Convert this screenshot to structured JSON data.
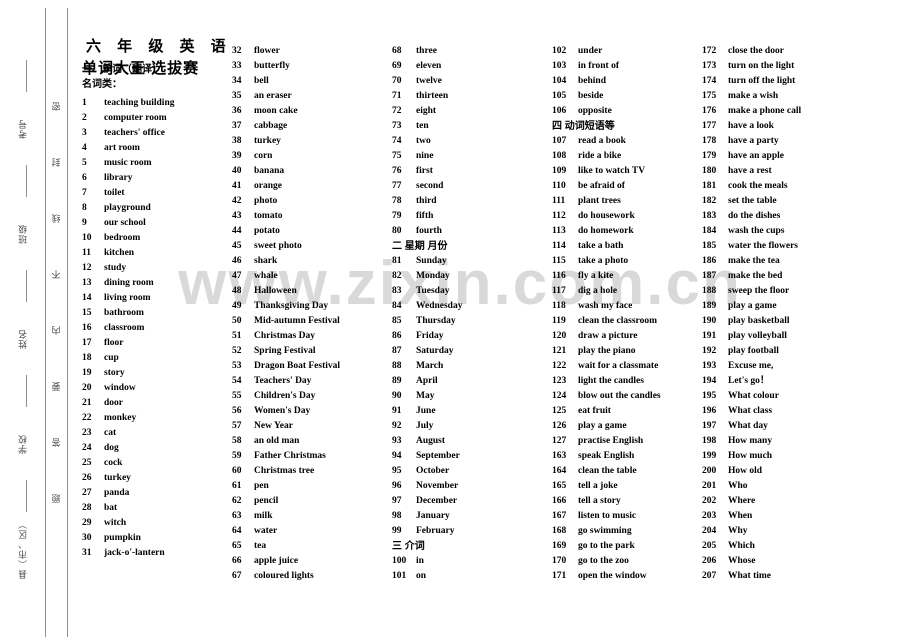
{
  "watermark": {
    "text": "www.zixin.com.cn"
  },
  "seal": {
    "outer_labels": [
      "考号",
      "班级",
      "姓名",
      "学校",
      "县（市、区）"
    ],
    "inner_chars": [
      "密",
      "封",
      "线",
      "不",
      "内",
      "要",
      "答",
      "题"
    ],
    "inner_text": "密封线内不要答题"
  },
  "header": {
    "title_line_1": "六 年 级 英 语",
    "title_line_2": "单词大王 选拔赛"
  },
  "sections": {
    "part_1": "一、单词（翻译）",
    "part_1_sub": "名词类：",
    "part_2": "二 星期 月份",
    "part_3": "三 介词",
    "part_4": "四 动词短语等"
  },
  "columns": [
    {
      "id": "col-1",
      "entries": [
        {
          "num": "1",
          "word": "teaching building"
        },
        {
          "num": "2",
          "word": "computer room"
        },
        {
          "num": "3",
          "word": "teachers' office"
        },
        {
          "num": "4",
          "word": "art    room"
        },
        {
          "num": "5",
          "word": "music    room"
        },
        {
          "num": "6",
          "word": "library"
        },
        {
          "num": "7",
          "word": "toilet"
        },
        {
          "num": "8",
          "word": "playground"
        },
        {
          "num": "9",
          "word": "our    school"
        },
        {
          "num": "10",
          "word": "bedroom"
        },
        {
          "num": "11",
          "word": "kitchen"
        },
        {
          "num": "12",
          "word": "study"
        },
        {
          "num": "13",
          "word": "dining room"
        },
        {
          "num": "14",
          "word": "living room"
        },
        {
          "num": "15",
          "word": "bathroom"
        },
        {
          "num": "16",
          "word": "classroom"
        },
        {
          "num": "17",
          "word": "floor"
        },
        {
          "num": "18",
          "word": "cup"
        },
        {
          "num": "19",
          "word": "story"
        },
        {
          "num": "20",
          "word": "window"
        },
        {
          "num": "21",
          "word": "door"
        },
        {
          "num": "22",
          "word": "monkey"
        },
        {
          "num": "23",
          "word": "cat"
        },
        {
          "num": "24",
          "word": "dog"
        },
        {
          "num": "25",
          "word": "cock"
        },
        {
          "num": "26",
          "word": "turkey"
        },
        {
          "num": "27",
          "word": "panda"
        },
        {
          "num": "28",
          "word": "bat"
        },
        {
          "num": "29",
          "word": "witch"
        },
        {
          "num": "30",
          "word": "pumpkin"
        },
        {
          "num": "31",
          "word": "jack-o'-lantern"
        }
      ]
    },
    {
      "id": "col-2",
      "entries": [
        {
          "num": "32",
          "word": "flower"
        },
        {
          "num": "33",
          "word": "butterfly"
        },
        {
          "num": "34",
          "word": "bell"
        },
        {
          "num": "35",
          "word": "an eraser"
        },
        {
          "num": "36",
          "word": "moon cake"
        },
        {
          "num": "37",
          "word": "cabbage"
        },
        {
          "num": "38",
          "word": "turkey"
        },
        {
          "num": "39",
          "word": "corn"
        },
        {
          "num": "40",
          "word": "banana"
        },
        {
          "num": "41",
          "word": "orange"
        },
        {
          "num": "42",
          "word": "photo"
        },
        {
          "num": "43",
          "word": "tomato"
        },
        {
          "num": "44",
          "word": "potato"
        },
        {
          "num": "45",
          "word": "sweet photo"
        },
        {
          "num": "46",
          "word": "shark"
        },
        {
          "num": "47",
          "word": "whale"
        },
        {
          "num": "48",
          "word": "Halloween"
        },
        {
          "num": "49",
          "word": "Thanksgiving Day"
        },
        {
          "num": "50",
          "word": "Mid-autumn Festival"
        },
        {
          "num": "51",
          "word": "Christmas Day"
        },
        {
          "num": "52",
          "word": "Spring Festival"
        },
        {
          "num": "53",
          "word": "Dragon Boat Festival"
        },
        {
          "num": "54",
          "word": "Teachers' Day"
        },
        {
          "num": "55",
          "word": "Children's Day"
        },
        {
          "num": "56",
          "word": "Women's Day"
        },
        {
          "num": "57",
          "word": "New Year"
        },
        {
          "num": "58",
          "word": "an old man"
        },
        {
          "num": "59",
          "word": "Father Christmas"
        },
        {
          "num": "60",
          "word": "Christmas   tree"
        },
        {
          "num": "61",
          "word": "pen"
        },
        {
          "num": "62",
          "word": "pencil"
        },
        {
          "num": "63",
          "word": "milk"
        },
        {
          "num": "64",
          "word": "water"
        },
        {
          "num": "65",
          "word": "tea"
        },
        {
          "num": "66",
          "word": "apple juice"
        },
        {
          "num": "67",
          "word": "coloured lights"
        }
      ]
    },
    {
      "id": "col-3",
      "entries": [
        {
          "num": "68",
          "word": "three"
        },
        {
          "num": "69",
          "word": "eleven"
        },
        {
          "num": "70",
          "word": "twelve"
        },
        {
          "num": "71",
          "word": "thirteen"
        },
        {
          "num": "72",
          "word": "eight"
        },
        {
          "num": "73",
          "word": "ten"
        },
        {
          "num": "74",
          "word": "two"
        },
        {
          "num": "75",
          "word": "nine"
        },
        {
          "num": "76",
          "word": "first"
        },
        {
          "num": "77",
          "word": "second"
        },
        {
          "num": "78",
          "word": "third"
        },
        {
          "num": "79",
          "word": "fifth"
        },
        {
          "num": "80",
          "word": "fourth"
        },
        {
          "section": "二 星期 月份"
        },
        {
          "num": "81",
          "word": "Sunday"
        },
        {
          "num": "82",
          "word": "Monday"
        },
        {
          "num": "83",
          "word": "Tuesday"
        },
        {
          "num": "84",
          "word": "Wednesday"
        },
        {
          "num": "85",
          "word": "Thursday"
        },
        {
          "num": "86",
          "word": "Friday"
        },
        {
          "num": "87",
          "word": "Saturday"
        },
        {
          "num": "88",
          "word": "March"
        },
        {
          "num": "89",
          "word": "April"
        },
        {
          "num": "90",
          "word": "May"
        },
        {
          "num": "91",
          "word": "June"
        },
        {
          "num": "92",
          "word": "July"
        },
        {
          "num": "93",
          "word": "August"
        },
        {
          "num": "94",
          "word": "September"
        },
        {
          "num": "95",
          "word": "October"
        },
        {
          "num": "96",
          "word": "November"
        },
        {
          "num": "97",
          "word": "December"
        },
        {
          "num": "98",
          "word": "January"
        },
        {
          "num": "99",
          "word": "February"
        },
        {
          "section": "三 介词"
        },
        {
          "num": "100",
          "word": "in"
        },
        {
          "num": "101",
          "word": "on"
        }
      ]
    },
    {
      "id": "col-4",
      "entries": [
        {
          "num": "102",
          "word": "under"
        },
        {
          "num": "103",
          "word": "in front of"
        },
        {
          "num": "104",
          "word": "behind"
        },
        {
          "num": "105",
          "word": "beside"
        },
        {
          "num": "106",
          "word": "opposite"
        },
        {
          "section": "四 动词短语等"
        },
        {
          "num": "107",
          "word": "read a book"
        },
        {
          "num": "108",
          "word": "ride a bike"
        },
        {
          "num": "109",
          "word": "like to watch TV"
        },
        {
          "num": "110",
          "word": "be afraid of"
        },
        {
          "num": "111",
          "word": "plant trees"
        },
        {
          "num": "112",
          "word": "do housework"
        },
        {
          "num": "113",
          "word": "do homework"
        },
        {
          "num": "114",
          "word": "take a bath"
        },
        {
          "num": "115",
          "word": "take a photo"
        },
        {
          "num": "116",
          "word": "fly a kite"
        },
        {
          "num": "117",
          "word": "dig a hole"
        },
        {
          "num": "118",
          "word": "wash my face"
        },
        {
          "num": "119",
          "word": "clean the classroom"
        },
        {
          "num": "120",
          "word": "draw a picture"
        },
        {
          "num": "121",
          "word": "play the piano"
        },
        {
          "num": "122",
          "word": "wait for a classmate"
        },
        {
          "num": "123",
          "word": "light the candles"
        },
        {
          "num": "124",
          "word": "blow out the candles"
        },
        {
          "num": "125",
          "word": "eat fruit"
        },
        {
          "num": "126",
          "word": "play a game"
        },
        {
          "num": "127",
          "word": "practise English"
        },
        {
          "num": "163",
          "word": "speak English"
        },
        {
          "num": "164",
          "word": "clean the table"
        },
        {
          "num": "165",
          "word": "tell a joke"
        },
        {
          "num": "166",
          "word": "tell a story"
        },
        {
          "num": "167",
          "word": "listen to music"
        },
        {
          "num": "168",
          "word": "go swimming"
        },
        {
          "num": "169",
          "word": "go to the park"
        },
        {
          "num": "170",
          "word": "go to the zoo"
        },
        {
          "num": "171",
          "word": "open the window"
        }
      ]
    },
    {
      "id": "col-5",
      "entries": [
        {
          "num": "172",
          "word": "close the door"
        },
        {
          "num": "173",
          "word": "turn on the light"
        },
        {
          "num": "174",
          "word": "turn off the light"
        },
        {
          "num": "175",
          "word": "make a wish"
        },
        {
          "num": "176",
          "word": "make a phone call"
        },
        {
          "num": "177",
          "word": "have a look"
        },
        {
          "num": "178",
          "word": "have a party"
        },
        {
          "num": "179",
          "word": "have an apple"
        },
        {
          "num": "180",
          "word": "have a rest"
        },
        {
          "num": "181",
          "word": "cook the meals"
        },
        {
          "num": "182",
          "word": "set the table"
        },
        {
          "num": "183",
          "word": "do the dishes"
        },
        {
          "num": "184",
          "word": "wash the cups"
        },
        {
          "num": "185",
          "word": "water the flowers"
        },
        {
          "num": "186",
          "word": "make the tea"
        },
        {
          "num": "187",
          "word": "make the bed"
        },
        {
          "num": "188",
          "word": "sweep the floor"
        },
        {
          "num": "189",
          "word": "play a game"
        },
        {
          "num": "190",
          "word": "play basketball"
        },
        {
          "num": "191",
          "word": "play volleyball"
        },
        {
          "num": "192",
          "word": "play football"
        },
        {
          "num": "193",
          "word": "Excuse me,"
        },
        {
          "num": "194",
          "word": "Let's go！"
        },
        {
          "num": "195",
          "word": "What colour"
        },
        {
          "num": "196",
          "word": "What class"
        },
        {
          "num": "197",
          "word": "What day"
        },
        {
          "num": "198",
          "word": "How many"
        },
        {
          "num": "199",
          "word": "How much"
        },
        {
          "num": "200",
          "word": "How old"
        },
        {
          "num": "201",
          "word": "Who"
        },
        {
          "num": "202",
          "word": "Where"
        },
        {
          "num": "203",
          "word": "When"
        },
        {
          "num": "204",
          "word": "Why"
        },
        {
          "num": "205",
          "word": "Which"
        },
        {
          "num": "206",
          "word": "Whose"
        },
        {
          "num": "207",
          "word": "What time"
        }
      ]
    }
  ]
}
